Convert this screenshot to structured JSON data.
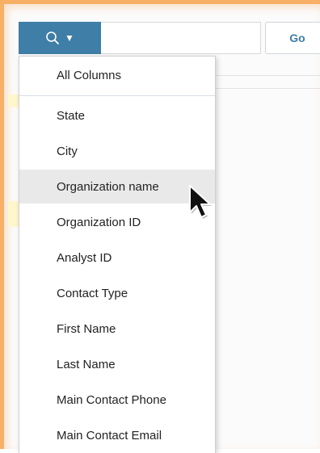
{
  "search": {
    "button_icon": "search-icon",
    "dropdown_icon": "caret-down-icon",
    "go_label": "Go"
  },
  "dropdown": {
    "header": "All Columns",
    "items": [
      {
        "label": "State"
      },
      {
        "label": "City"
      },
      {
        "label": "Organization name",
        "hovered": true
      },
      {
        "label": "Organization ID"
      },
      {
        "label": "Analyst ID"
      },
      {
        "label": "Contact Type"
      },
      {
        "label": "First Name"
      },
      {
        "label": "Last Name"
      },
      {
        "label": "Main Contact Phone"
      },
      {
        "label": "Main Contact Email"
      }
    ]
  },
  "colors": {
    "accent": "#3f7ea6",
    "frame": "#f7b066",
    "hover": "#e9e9ea"
  }
}
